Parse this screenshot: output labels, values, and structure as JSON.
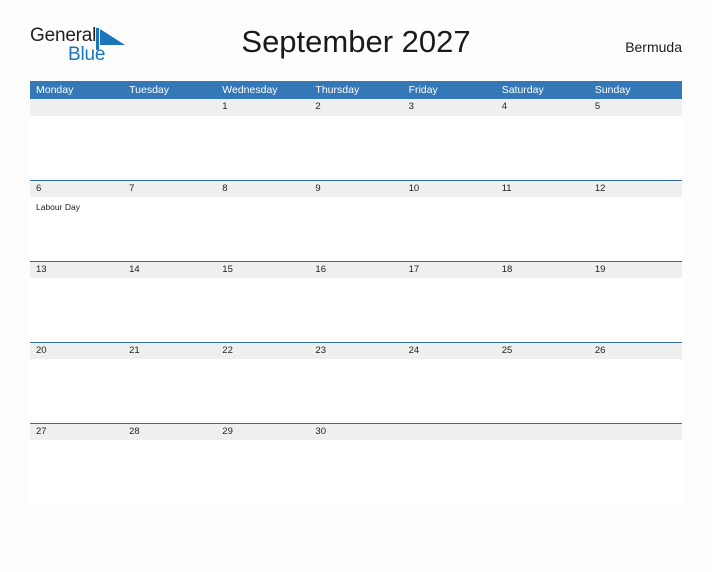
{
  "brand": {
    "name_part1": "General",
    "name_part2": "Blue",
    "flag_color": "#1b75bb",
    "text_color": "#231f20"
  },
  "header": {
    "title": "September 2027",
    "region": "Bermuda"
  },
  "theme": {
    "header_blue": "#3478b8",
    "band_gray": "#efefef",
    "band_border": "#2f6ca8",
    "page_background": "#fdfdfd"
  },
  "calendar": {
    "weekdays": [
      "Monday",
      "Tuesday",
      "Wednesday",
      "Thursday",
      "Friday",
      "Saturday",
      "Sunday"
    ],
    "weeks": [
      [
        {
          "date": "",
          "events": []
        },
        {
          "date": "",
          "events": []
        },
        {
          "date": "1",
          "events": []
        },
        {
          "date": "2",
          "events": []
        },
        {
          "date": "3",
          "events": []
        },
        {
          "date": "4",
          "events": []
        },
        {
          "date": "5",
          "events": []
        }
      ],
      [
        {
          "date": "6",
          "events": [
            "Labour Day"
          ]
        },
        {
          "date": "7",
          "events": []
        },
        {
          "date": "8",
          "events": []
        },
        {
          "date": "9",
          "events": []
        },
        {
          "date": "10",
          "events": []
        },
        {
          "date": "11",
          "events": []
        },
        {
          "date": "12",
          "events": []
        }
      ],
      [
        {
          "date": "13",
          "events": []
        },
        {
          "date": "14",
          "events": []
        },
        {
          "date": "15",
          "events": []
        },
        {
          "date": "16",
          "events": []
        },
        {
          "date": "17",
          "events": []
        },
        {
          "date": "18",
          "events": []
        },
        {
          "date": "19",
          "events": []
        }
      ],
      [
        {
          "date": "20",
          "events": []
        },
        {
          "date": "21",
          "events": []
        },
        {
          "date": "22",
          "events": []
        },
        {
          "date": "23",
          "events": []
        },
        {
          "date": "24",
          "events": []
        },
        {
          "date": "25",
          "events": []
        },
        {
          "date": "26",
          "events": []
        }
      ],
      [
        {
          "date": "27",
          "events": []
        },
        {
          "date": "28",
          "events": []
        },
        {
          "date": "29",
          "events": []
        },
        {
          "date": "30",
          "events": []
        },
        {
          "date": "",
          "events": []
        },
        {
          "date": "",
          "events": []
        },
        {
          "date": "",
          "events": []
        }
      ]
    ]
  }
}
